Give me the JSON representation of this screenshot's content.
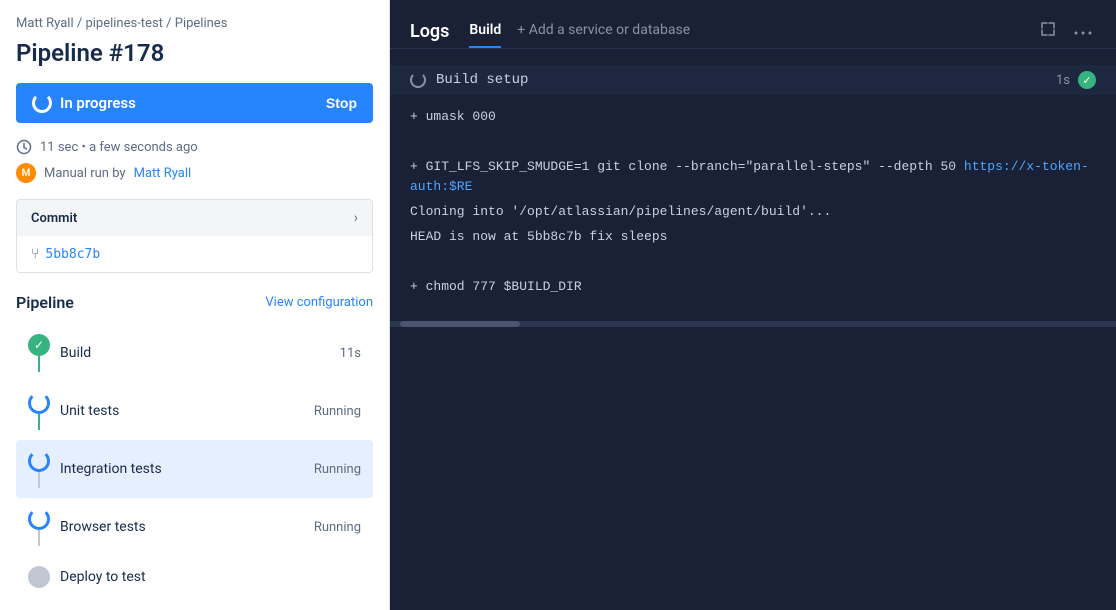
{
  "breadcrumb": {
    "user": "Matt Ryall",
    "repo": "pipelines-test",
    "section": "Pipelines"
  },
  "page": {
    "title": "Pipeline #178"
  },
  "progress": {
    "label": "In progress",
    "stop_label": "Stop"
  },
  "meta": {
    "duration": "11 sec",
    "time_ago": "a few seconds ago",
    "run_by_prefix": "Manual run by",
    "run_by_user": "Matt Ryall"
  },
  "commit": {
    "label": "Commit",
    "hash": "5bb8c7b"
  },
  "pipeline": {
    "label": "Pipeline",
    "view_config": "View configuration",
    "steps": [
      {
        "name": "Build",
        "status": "11s",
        "type": "success",
        "line_after": "green"
      },
      {
        "name": "Unit tests",
        "status": "Running",
        "type": "running",
        "line_after": "green"
      },
      {
        "name": "Integration tests",
        "status": "Running",
        "type": "running",
        "line_after": "gray",
        "active": true
      },
      {
        "name": "Browser tests",
        "status": "Running",
        "type": "running",
        "line_after": "gray"
      },
      {
        "name": "Deploy to test",
        "status": "",
        "type": "pending",
        "line_after": ""
      }
    ]
  },
  "logs": {
    "title": "Logs",
    "tabs": [
      {
        "label": "Build",
        "active": true
      },
      {
        "label": "+ Add a service or database",
        "active": false
      }
    ],
    "sections": [
      {
        "title": "Build setup",
        "duration": "1s",
        "completed": true,
        "lines": [
          "+ umask 000",
          "",
          "+ GIT_LFS_SKIP_SMUDGE=1 git clone --branch=\"parallel-steps\" --depth 50 https://x-token-auth:$RE",
          "Cloning into '/opt/atlassian/pipelines/agent/build'...",
          "HEAD is now at 5bb8c7b fix sleeps",
          "",
          "+ chmod 777 $BUILD_DIR"
        ]
      }
    ]
  }
}
